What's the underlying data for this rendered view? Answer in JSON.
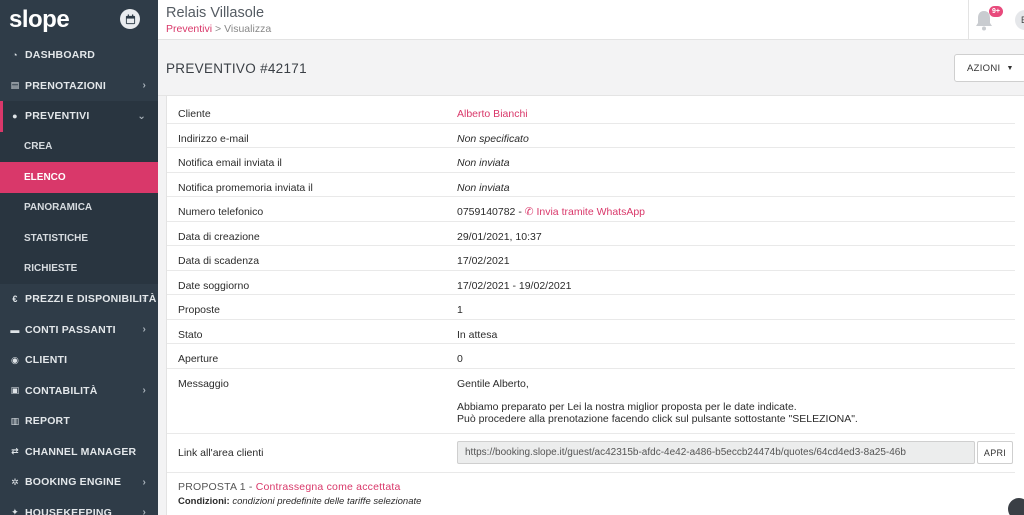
{
  "app": {
    "logo": "slope"
  },
  "sidebar": {
    "items": [
      {
        "label": "DASHBOARD",
        "icon": "dashboard-icon",
        "chev": ""
      },
      {
        "label": "PRENOTAZIONI",
        "icon": "book-icon",
        "chev": "›"
      },
      {
        "label": "PREVENTIVI",
        "icon": "circle-icon",
        "chev": "⌄"
      },
      {
        "label": "PREZZI E DISPONIBILITÀ",
        "icon": "euro-icon",
        "chev": "›"
      },
      {
        "label": "CONTI PASSANTI",
        "icon": "wallet-icon",
        "chev": "›"
      },
      {
        "label": "CLIENTI",
        "icon": "users-icon",
        "chev": ""
      },
      {
        "label": "CONTABILITÀ",
        "icon": "money-icon",
        "chev": "›"
      },
      {
        "label": "REPORT",
        "icon": "chart-icon",
        "chev": ""
      },
      {
        "label": "CHANNEL MANAGER",
        "icon": "exchange-icon",
        "chev": ""
      },
      {
        "label": "BOOKING ENGINE",
        "icon": "cogs-icon",
        "chev": "›"
      },
      {
        "label": "HOUSEKEEPING",
        "icon": "broom-icon",
        "chev": "›"
      }
    ],
    "subitems": [
      "CREA",
      "ELENCO",
      "PANORAMICA",
      "STATISTICHE",
      "RICHIESTE"
    ]
  },
  "header": {
    "title": "Relais Villasole",
    "crumb_link": "Preventivi",
    "crumb_rest": " > Visualizza",
    "badge": "9+",
    "avatar": "E"
  },
  "page": {
    "title": "PREVENTIVO #42171",
    "azioni": "AZIONI"
  },
  "details": {
    "cliente_label": "Cliente",
    "cliente": "Alberto Bianchi",
    "email_label": "Indirizzo e-mail",
    "email": "Non specificato",
    "notifica_label": "Notifica email inviata il",
    "notifica": "Non inviata",
    "promemoria_label": "Notifica promemoria inviata il",
    "promemoria": "Non inviata",
    "telefono_label": "Numero telefonico",
    "telefono": "0759140782 -",
    "whatsapp": "Invia tramite WhatsApp",
    "creazione_label": "Data di creazione",
    "creazione": "29/01/2021, 10:37",
    "scadenza_label": "Data di scadenza",
    "scadenza": "17/02/2021",
    "soggiorno_label": "Date soggiorno",
    "soggiorno": "17/02/2021 - 19/02/2021",
    "proposte_label": "Proposte",
    "proposte": "1",
    "stato_label": "Stato",
    "stato": "In attesa",
    "aperture_label": "Aperture",
    "aperture": "0",
    "messaggio_label": "Messaggio",
    "messaggio_1": "Gentile Alberto,",
    "messaggio_2": "Abbiamo preparato per Lei la nostra miglior proposta per le date indicate.",
    "messaggio_3": "Può procedere alla prenotazione facendo click sul pulsante sottostante \"SELEZIONA\".",
    "link_label": "Link all'area clienti",
    "link": "https://booking.slope.it/guest/ac42315b-afdc-4e42-a486-b5eccb24474b/quotes/64cd4ed3-8a25-46b",
    "apri": "APRI"
  },
  "proposta": {
    "title": "PROPOSTA 1",
    "sep": " - ",
    "accept": "Contrassegna come accettata",
    "cond_label": "Condizioni:",
    "cond": "condizioni predefinite delle tariffe selezionate"
  },
  "colors": {
    "accent": "#d9386a",
    "sidebar": "#2f3c48"
  }
}
